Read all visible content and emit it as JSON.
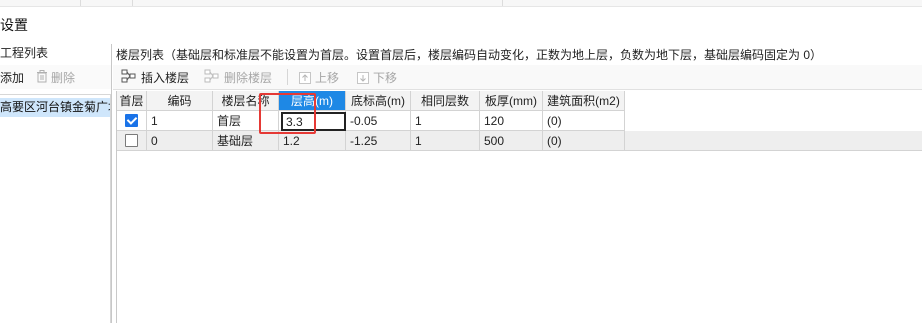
{
  "window": {
    "title": "设置"
  },
  "left_panel": {
    "header": "工程列表",
    "toolbar": {
      "add_label": "添加",
      "delete_label": "删除"
    },
    "items": [
      "高要区河台镇金菊广场"
    ]
  },
  "right_panel": {
    "header": "楼层列表（基础层和标准层不能设置为首层。设置首层后，楼层编码自动变化，正数为地上层，负数为地下层，基础层编码固定为 0）",
    "toolbar": {
      "insert_label": "插入楼层",
      "delete_label": "删除楼层",
      "up_label": "上移",
      "down_label": "下移"
    }
  },
  "table": {
    "columns": [
      "首层",
      "编码",
      "楼层名称",
      "层高(m)",
      "底标高(m)",
      "相同层数",
      "板厚(mm)",
      "建筑面积(m2)"
    ],
    "rows": [
      {
        "first_floor": true,
        "code": "1",
        "name": "首层",
        "height": "3.3",
        "bottom_elev": "-0.05",
        "same_count": "1",
        "slab": "120",
        "area": "(0)"
      },
      {
        "first_floor": false,
        "code": "0",
        "name": "基础层",
        "height": "1.2",
        "bottom_elev": "-1.25",
        "same_count": "1",
        "slab": "500",
        "area": "(0)"
      }
    ],
    "active_column": "层高(m)",
    "editing_value": "3.3"
  },
  "colors": {
    "selection": "#cfe6fb",
    "active_header": "#1e88e5",
    "checkbox": "#1a73e8",
    "highlight_box": "#e53935"
  }
}
